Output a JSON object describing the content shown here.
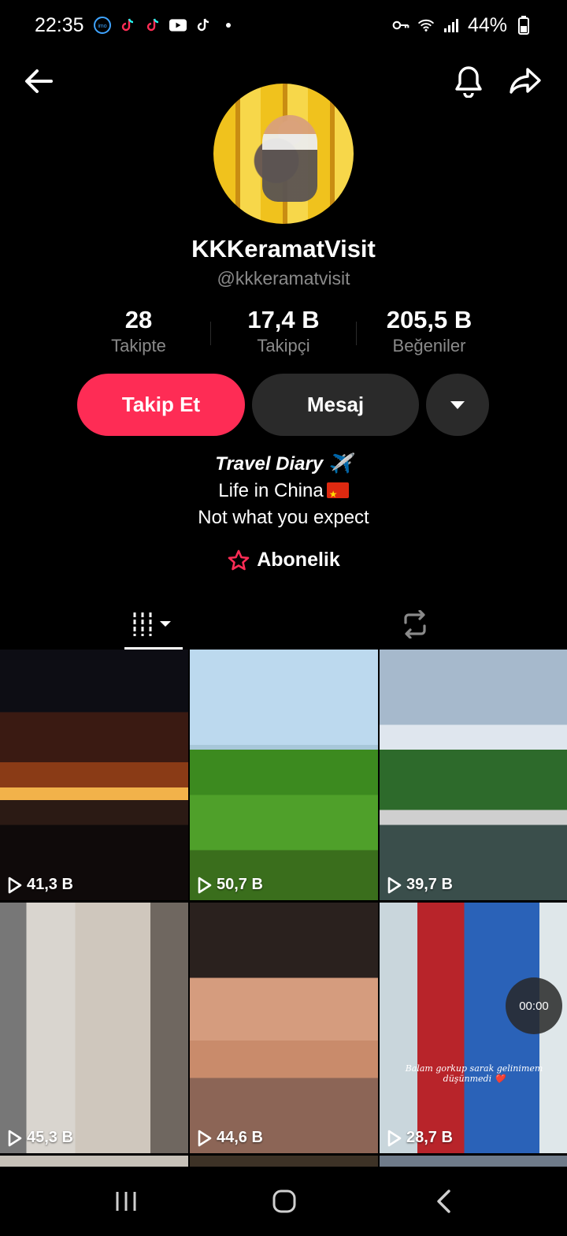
{
  "status_bar": {
    "time": "22:35",
    "left_icons": [
      "imo-icon",
      "tiktok-icon",
      "tiktok-icon",
      "youtube-icon",
      "tiktok-icon",
      "dot-icon"
    ],
    "right_icons": [
      "key-icon",
      "wifi-icon",
      "signal-icon"
    ],
    "battery": "44%"
  },
  "nav": {
    "icons": [
      "arrow-left-icon",
      "bell-icon",
      "share-icon"
    ]
  },
  "profile": {
    "display_name": "KKKeramatVisit",
    "username": "@kkkeramatvisit"
  },
  "stats": [
    {
      "value": "28",
      "label": "Takipte"
    },
    {
      "value": "17,4 B",
      "label": "Takipçi"
    },
    {
      "value": "205,5 B",
      "label": "Beğeniler"
    }
  ],
  "actions": {
    "follow": "Takip Et",
    "message": "Mesaj"
  },
  "bio": {
    "line1": "Travel Diary ✈️",
    "line2": "Life in China",
    "line3": "Not what you expect"
  },
  "subscription": {
    "label": "Abonelik"
  },
  "colors": {
    "accent": "#fe2c55",
    "secondary_button": "#2a2a2a",
    "muted_text": "#8a8a8a",
    "background": "#000000"
  },
  "grid": [
    {
      "views": "41,3 B"
    },
    {
      "views": "50,7 B"
    },
    {
      "views": "39,7 B"
    },
    {
      "views": "45,3 B"
    },
    {
      "views": "44,6 B"
    },
    {
      "views": "28,7 B",
      "caption": "Balam gorkup sarak gelinimem düşünmedi ❤️",
      "timer": "00:00"
    }
  ]
}
